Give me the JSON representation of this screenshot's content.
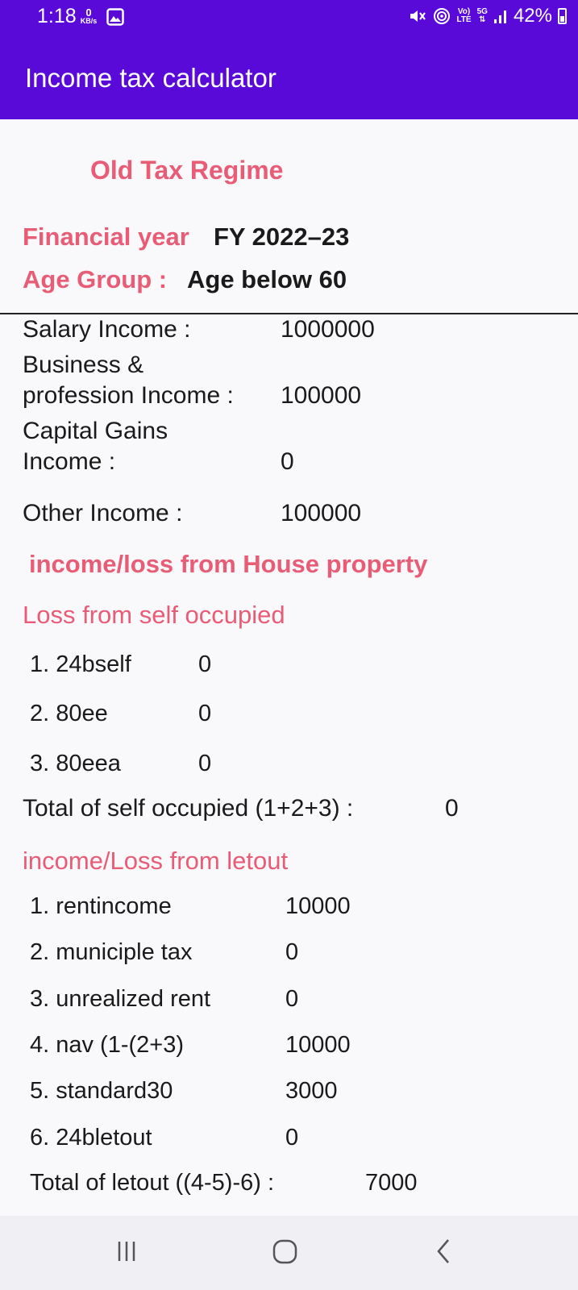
{
  "status": {
    "time": "1:18",
    "speed_value": "0",
    "speed_unit": "KB/s",
    "network_top": "Vo)",
    "network_bottom": "LTE",
    "gen_top": "5G",
    "battery": "42%"
  },
  "app": {
    "title": "Income tax calculator"
  },
  "header": {
    "regime": "Old Tax Regime",
    "fy_label": "Financial year",
    "fy_value": "FY 2022–23",
    "age_label": "Age Group :",
    "age_value": "Age below 60"
  },
  "income": {
    "salary_label": "Salary Income :",
    "salary_value": "1000000",
    "business_label_1": "Business &",
    "business_label_2": "profession Income :",
    "business_value": "100000",
    "capital_label_1": "Capital Gains",
    "capital_label_2": "Income :",
    "capital_value": "0",
    "other_label": "Other Income :",
    "other_value": "100000"
  },
  "house": {
    "heading": "income/loss from House property",
    "self_heading": "Loss from self occupied",
    "self_items": [
      {
        "label": "1. 24bself",
        "value": "0"
      },
      {
        "label": "2. 80ee",
        "value": "0"
      },
      {
        "label": "3. 80eea",
        "value": "0"
      }
    ],
    "self_total_label": "Total of self occupied (1+2+3) :",
    "self_total_value": "0",
    "letout_heading": "income/Loss from letout",
    "letout_items": [
      {
        "label": "1. rentincome",
        "value": "10000"
      },
      {
        "label": "2. municiple tax",
        "value": "0"
      },
      {
        "label": "3. unrealized rent",
        "value": "0"
      },
      {
        "label": "4. nav (1-(2+3)",
        "value": "10000"
      },
      {
        "label": "5. standard30",
        "value": "3000"
      },
      {
        "label": "6. 24bletout",
        "value": "0"
      }
    ],
    "letout_total_label": "Total of letout ((4-5)-6) :",
    "letout_total_value": "7000"
  },
  "icons": {
    "gallery": "image-icon",
    "mute": "mute-vibrate-icon",
    "hotspot": "hotspot-icon",
    "signal": "signal-icon",
    "battery": "battery-icon",
    "recents": "recents-icon",
    "home": "home-icon",
    "back": "back-icon"
  },
  "colors": {
    "app_bar": "#5a0ad8",
    "accent_pink": "#e85c76",
    "background": "#f9f9fb"
  }
}
